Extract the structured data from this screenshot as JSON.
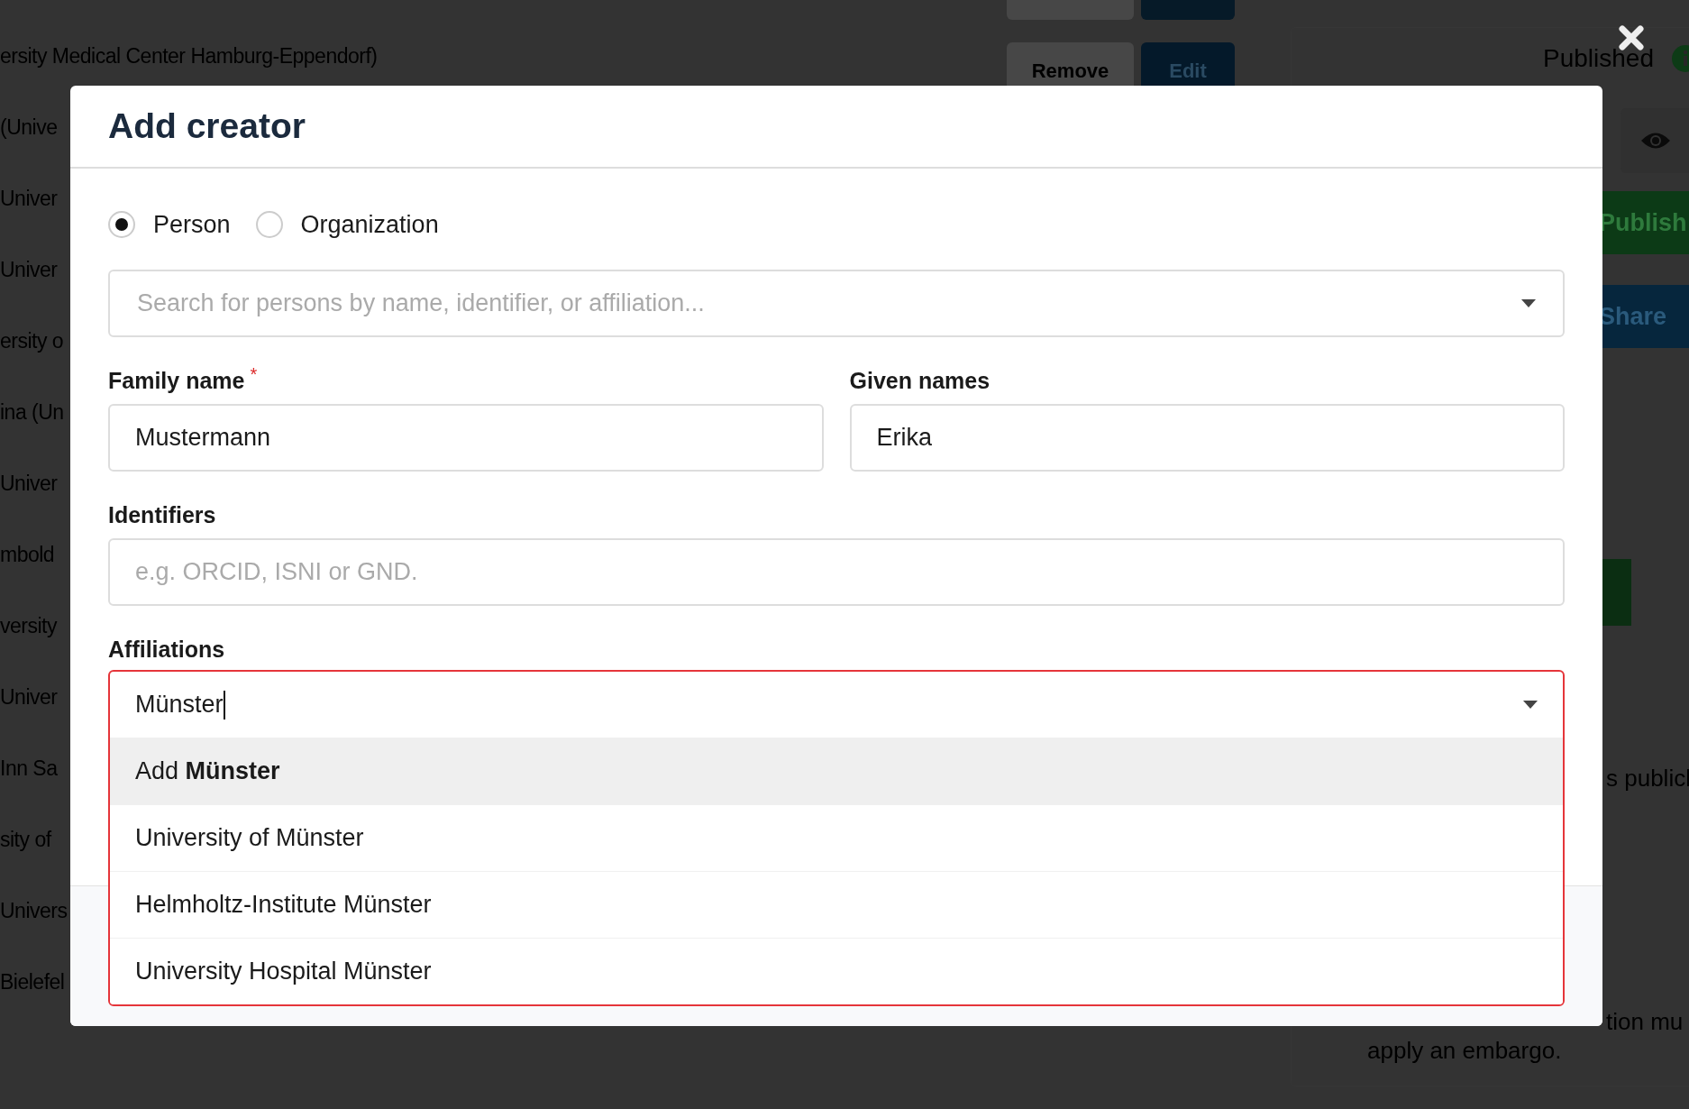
{
  "background": {
    "list_items": [
      "ersity Medical Center Hamburg-Eppendorf)",
      "(Unive",
      "Univer",
      "Univer",
      "ersity o",
      "ina (Un",
      "Univer",
      "mbold",
      "versity",
      "Univer",
      "Inn Sa",
      "sity of",
      "Univers",
      "Bielefel"
    ],
    "row_buttons": [
      {
        "label": "Remove",
        "kind": "secondary"
      },
      {
        "label": "Edit",
        "kind": "primary"
      }
    ],
    "status": "Published",
    "actions": [
      {
        "label": "Publish",
        "kind": "success"
      },
      {
        "label": "Share",
        "kind": "primary"
      }
    ],
    "notes": [
      "s publicl",
      "tion mu",
      "apply an embargo."
    ]
  },
  "modal": {
    "title": "Add creator",
    "types": [
      {
        "label": "Person",
        "selected": true
      },
      {
        "label": "Organization",
        "selected": false
      }
    ],
    "search": {
      "placeholder": "Search for persons by name, identifier, or affiliation..."
    },
    "family_name": {
      "label": "Family name",
      "required_mark": "*",
      "value": "Mustermann"
    },
    "given_names": {
      "label": "Given names",
      "value": "Erika"
    },
    "identifiers": {
      "label": "Identifiers",
      "placeholder": "e.g. ORCID, ISNI or GND."
    },
    "affiliations": {
      "label": "Affiliations",
      "value": "Münster",
      "options": [
        {
          "label": "Add **Münster**",
          "selected": true
        },
        {
          "label": "University of Münster",
          "selected": false
        },
        {
          "label": "Helmholtz-Institute Münster",
          "selected": false
        },
        {
          "label": "University Hospital Münster",
          "selected": false
        }
      ]
    }
  }
}
